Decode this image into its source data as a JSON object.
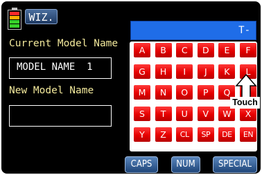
{
  "header": {
    "wizard_button_label": "WIZ.",
    "battery": {
      "cells": [
        "#ff2a2a",
        "#ffb000",
        "#37d12a",
        "#37d12a"
      ],
      "level": 0.8
    }
  },
  "current_model": {
    "label": "Current Model Name",
    "value": "MODEL NAME  1"
  },
  "new_model": {
    "label": "New Model Name",
    "value": ""
  },
  "entry_display": {
    "text": "T-"
  },
  "keyboard": {
    "rows": [
      [
        "A",
        "B",
        "C",
        "D",
        "E",
        "F"
      ],
      [
        "G",
        "H",
        "I",
        "J",
        "K",
        "L"
      ],
      [
        "M",
        "N",
        "O",
        "P",
        "Q",
        "R"
      ],
      [
        "S",
        "T",
        "U",
        "V",
        "W",
        "X"
      ],
      [
        "Y",
        "Z",
        "CL",
        "SP",
        "DE",
        "EN"
      ]
    ]
  },
  "function_buttons": {
    "caps": "CAPS",
    "num": "NUM",
    "special": "SPECIAL"
  },
  "annotation": {
    "touch_label": "Touch"
  },
  "colors": {
    "key_red": "#e60000",
    "label_yellow": "#f2e89b",
    "entry_blue": "#1f6de8",
    "button_blue": "#1e4478"
  }
}
